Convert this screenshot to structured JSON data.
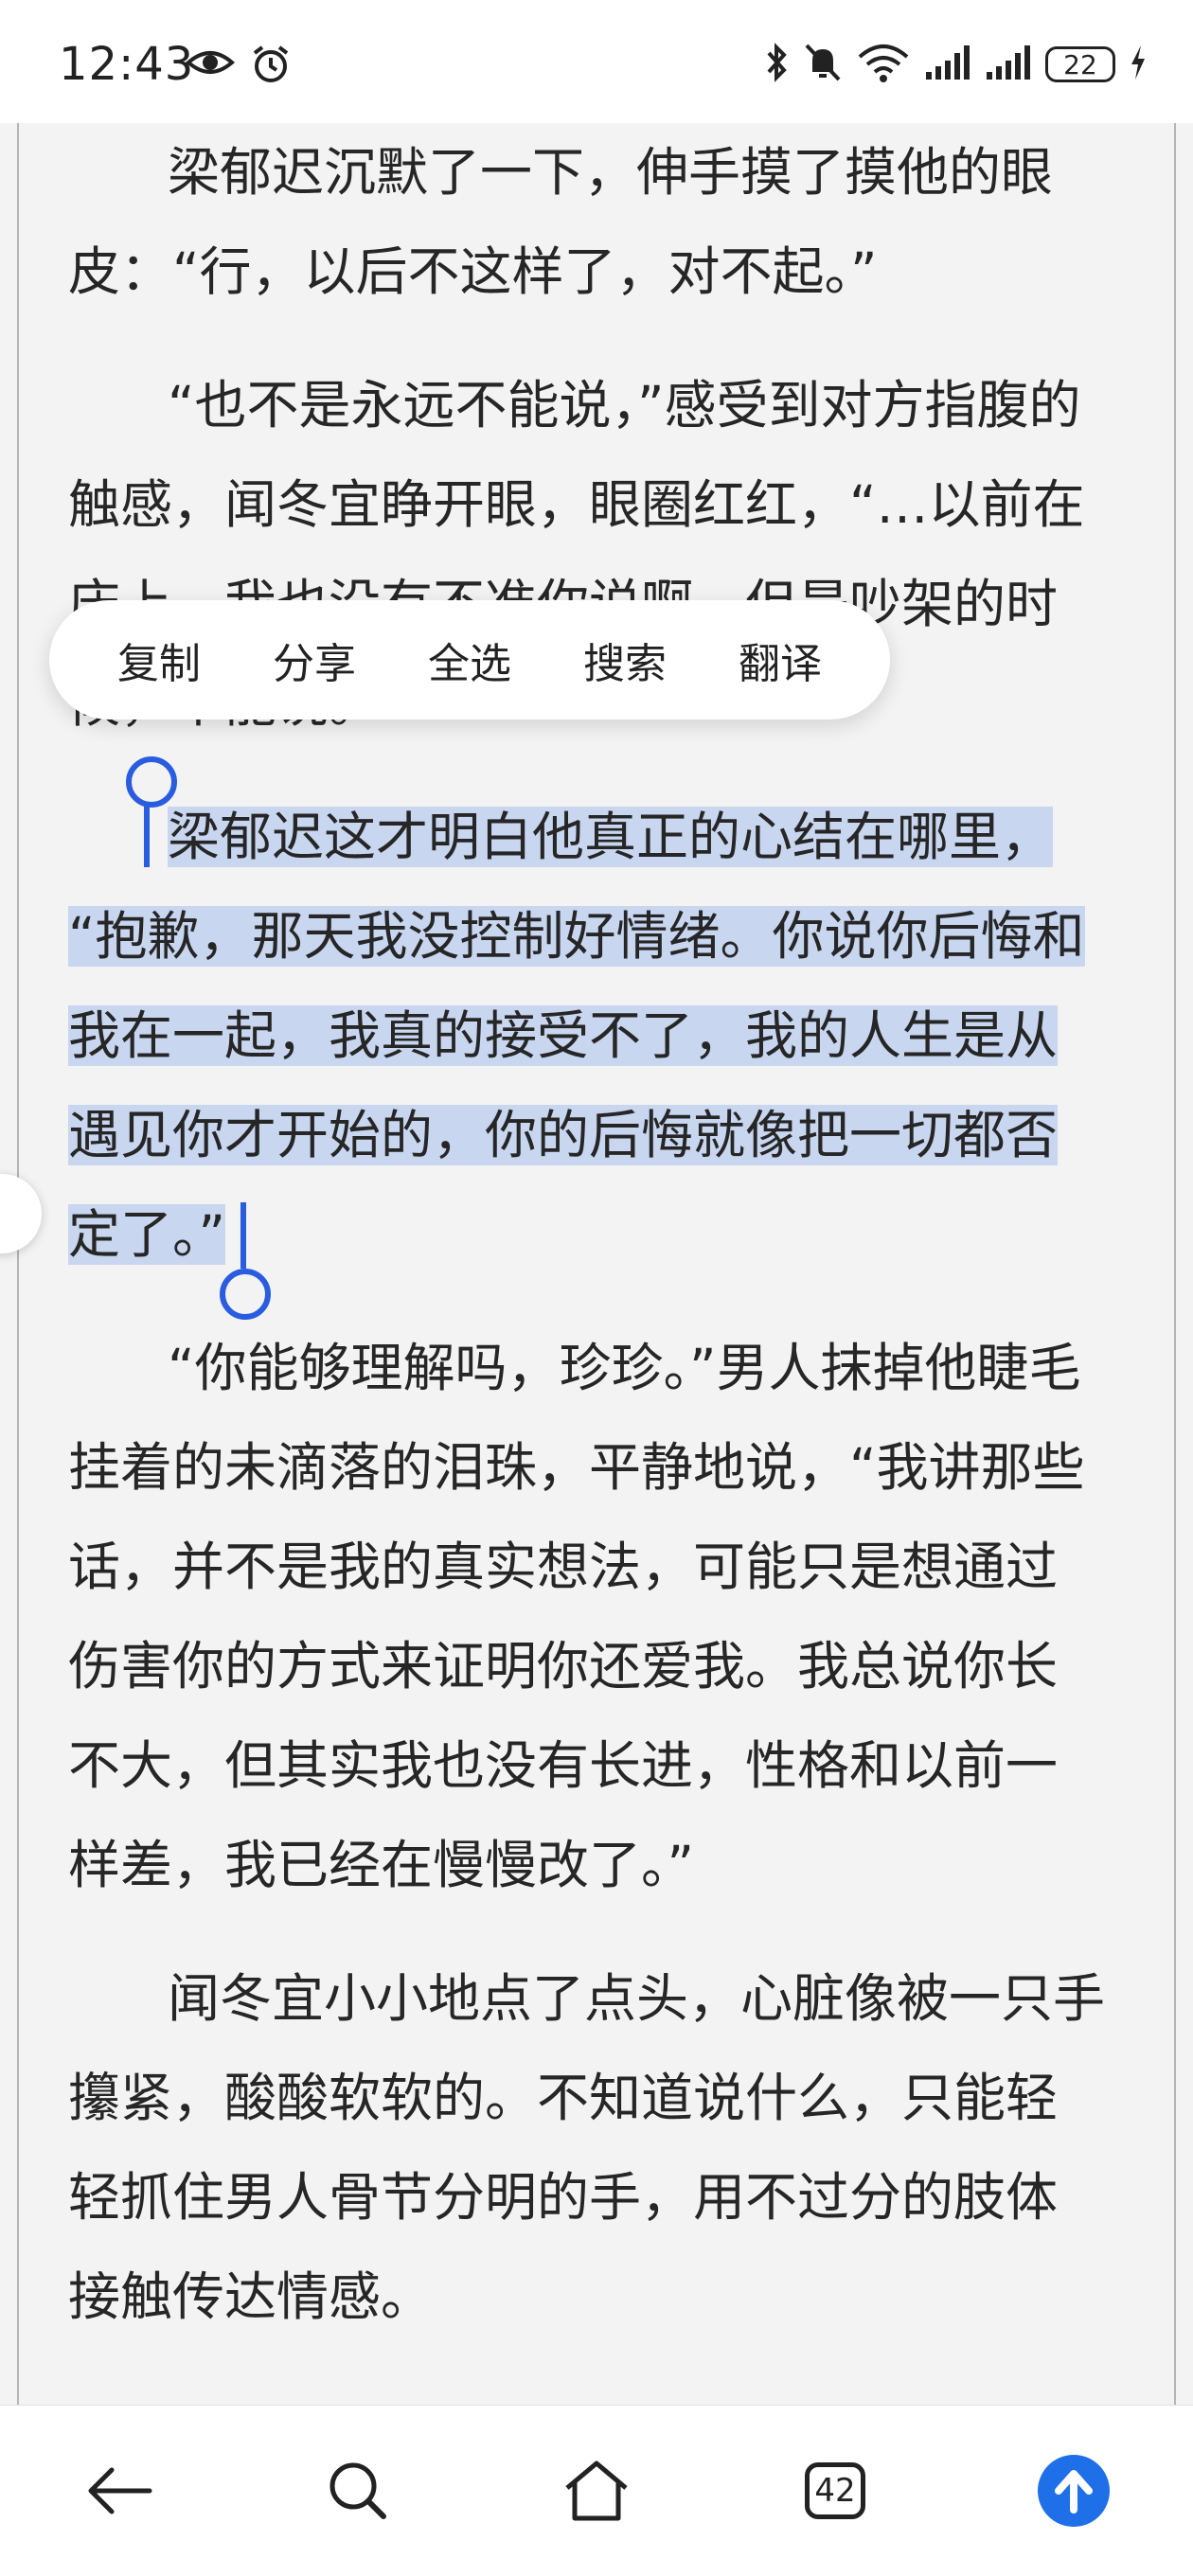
{
  "status_bar": {
    "time": "12:43",
    "battery": "22",
    "icons": [
      "eye-icon",
      "alarm-icon",
      "bluetooth-icon",
      "mute-icon",
      "wifi-icon",
      "signal-icon",
      "signal-icon",
      "battery-icon",
      "charging-icon"
    ]
  },
  "article": {
    "paragraphs": [
      {
        "lines": [
          "梁郁迟沉默了一下，伸手摸了摸他的眼",
          "皮：“行，以后不这样了，对不起。”"
        ]
      },
      {
        "lines": [
          "“也不是永远不能说，”感受到对方指腹的",
          "触感，闻冬宜睁开眼，眼圈红红，“…以前在",
          "床上，我也没有不准你说啊。但是吵架的时",
          "候，不能说。"
        ]
      },
      {
        "lines": [
          "梁郁迟这才明白他真正的心结在哪里，",
          "“抱歉，那天我没控制好情绪。你说你后悔和",
          "我在一起，我真的接受不了，我的人生是从",
          "遇见你才开始的，你的后悔就像把一切都否",
          "定了。”"
        ]
      },
      {
        "lines": [
          "“你能够理解吗，珍珍。”男人抹掉他睫毛",
          "挂着的未滴落的泪珠，平静地说，“我讲那些",
          "话，并不是我的真实想法，可能只是想通过",
          "伤害你的方式来证明你还爱我。我总说你长",
          "不大，但其实我也没有长进，性格和以前一",
          "样差，我已经在慢慢改了。”"
        ]
      },
      {
        "lines": [
          "闻冬宜小小地点了点头，心脏像被一只手",
          "攥紧，酸酸软软的。不知道说什么，只能轻",
          "轻抓住男人骨节分明的手，用不过分的肢体",
          "接触传达情感。"
        ]
      }
    ]
  },
  "context_menu": {
    "copy": "复制",
    "share": "分享",
    "select_all": "全选",
    "search": "搜索",
    "translate": "翻译"
  },
  "nav": {
    "tab_count": "42",
    "accent": "#1f6fe8"
  },
  "colors": {
    "selection": "#c8d6f0",
    "handle": "#2a5ce0"
  }
}
